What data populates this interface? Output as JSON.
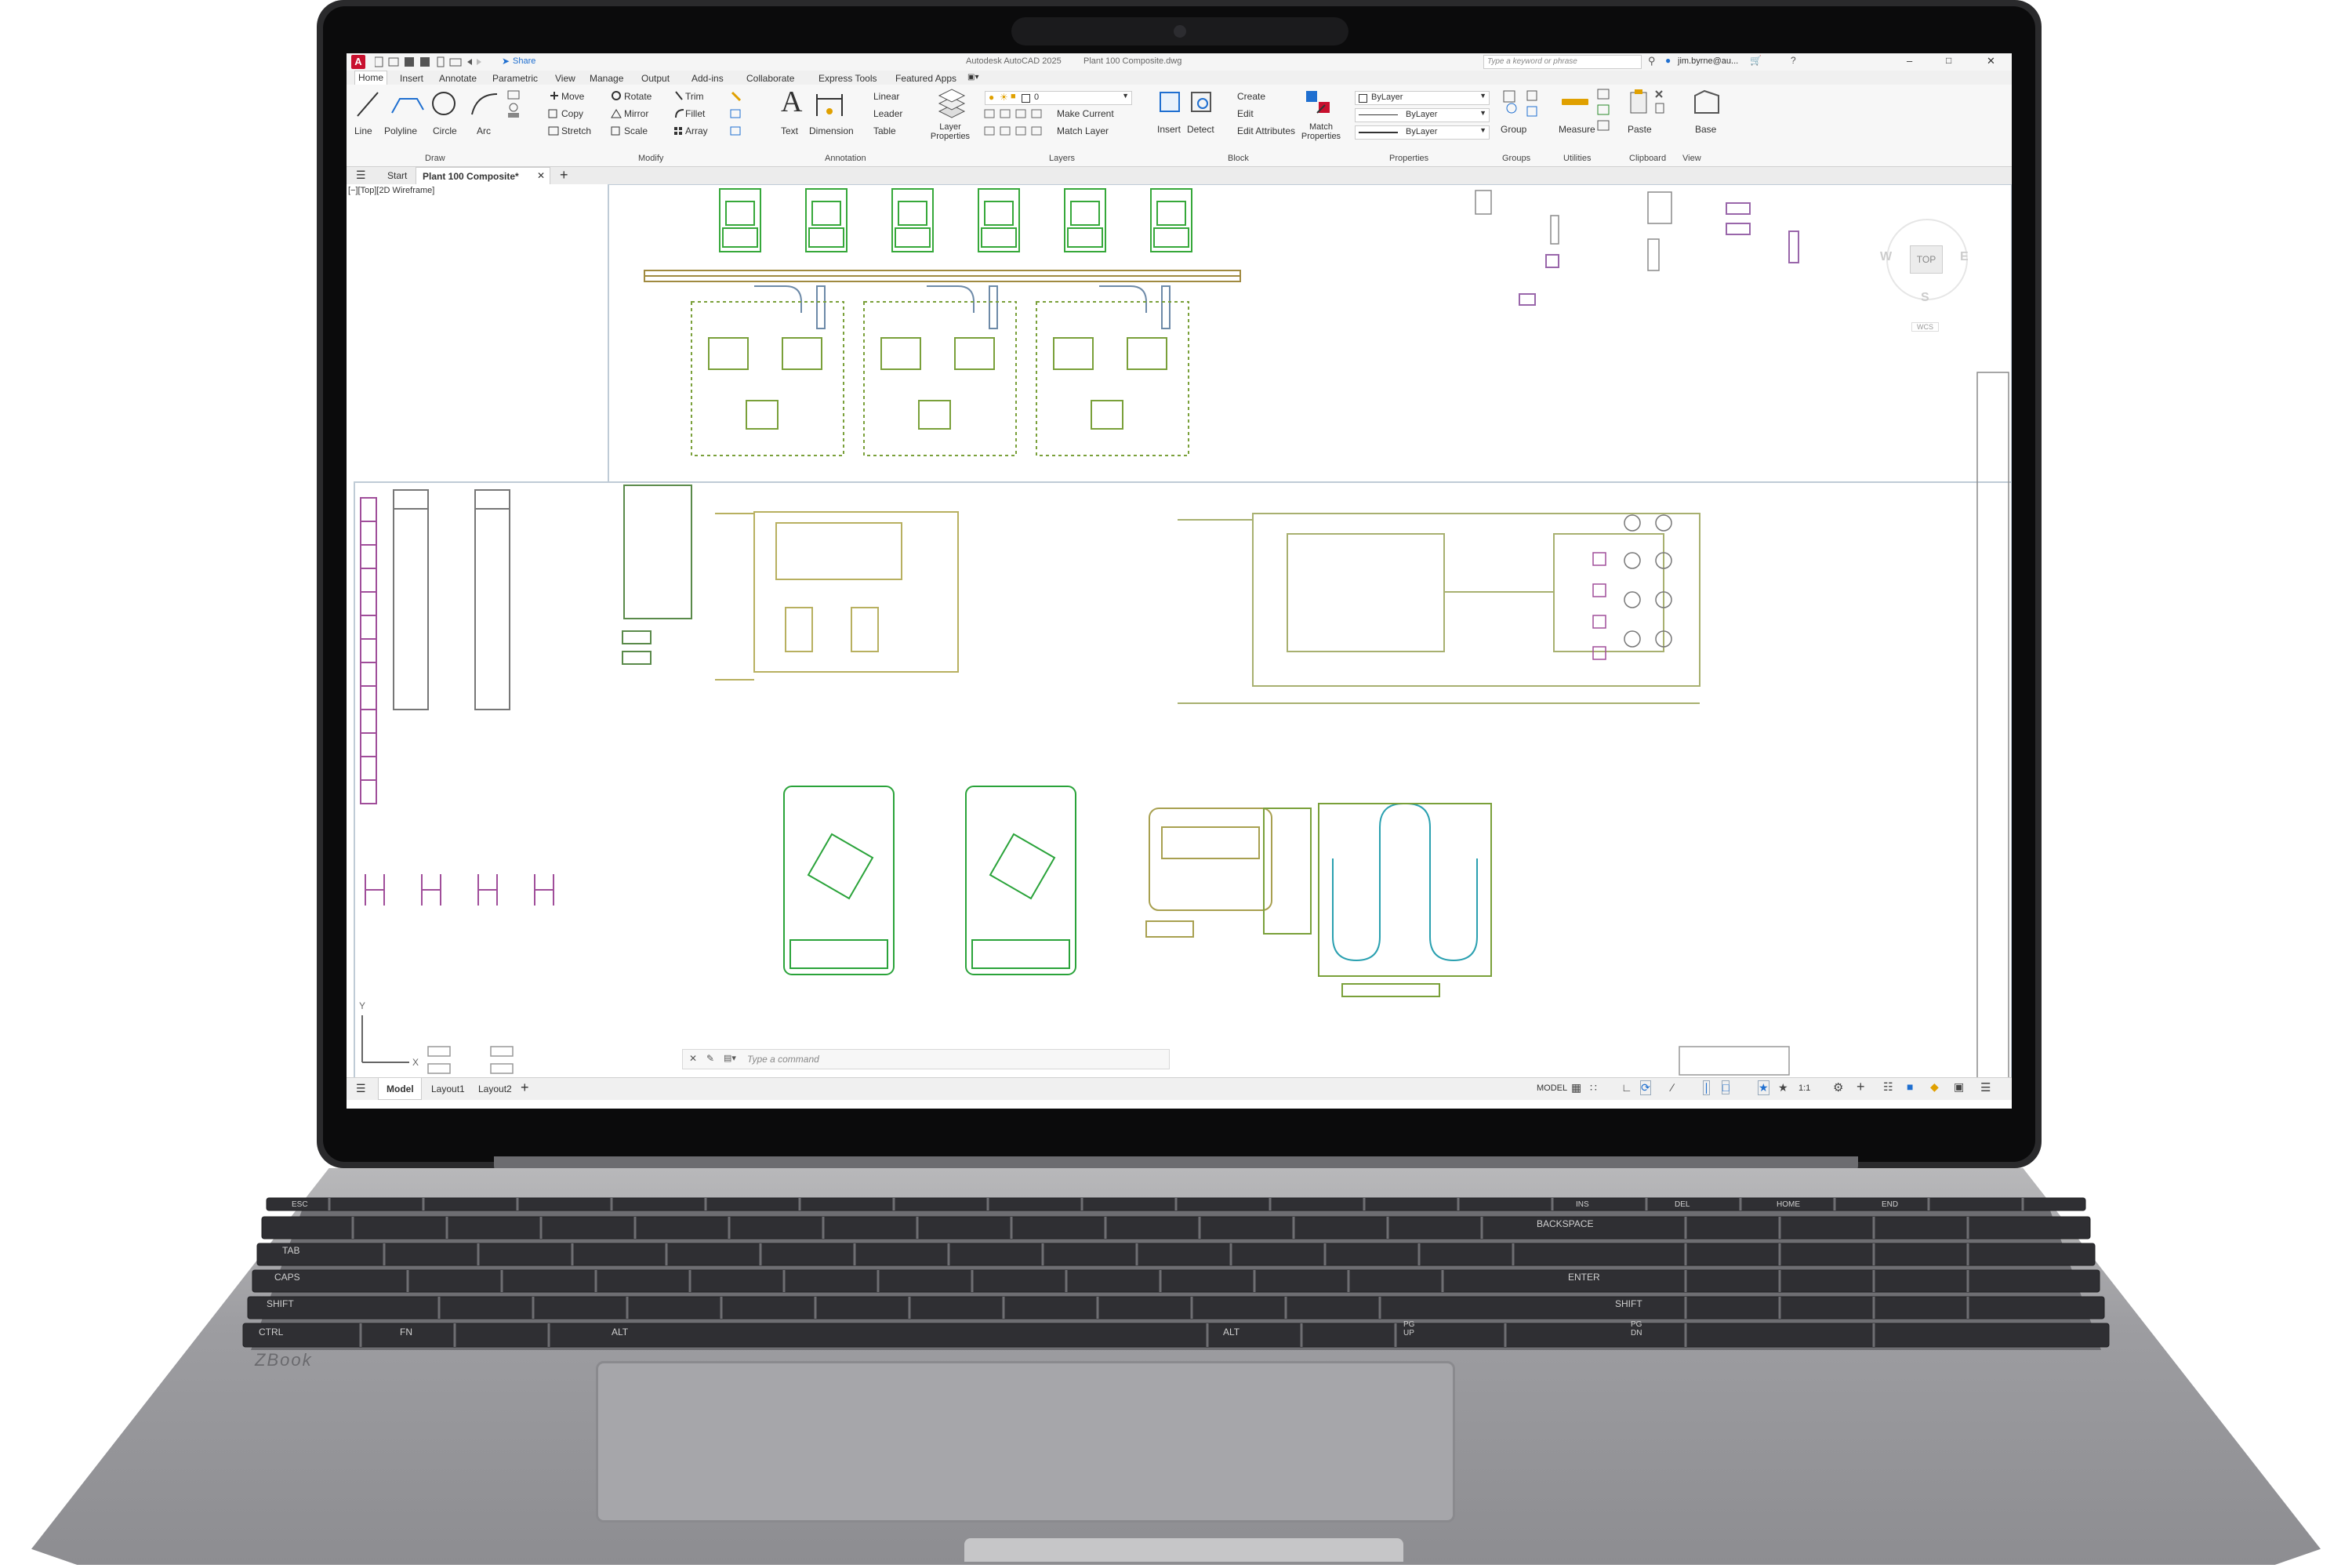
{
  "app": {
    "title": "Autodesk AutoCAD 2025",
    "filename": "Plant 100 Composite.dwg",
    "share_label": "Share",
    "search_placeholder": "Type a keyword or phrase",
    "user": "jim.byrne@au..."
  },
  "ribbon_tabs": [
    "Home",
    "Insert",
    "Annotate",
    "Parametric",
    "View",
    "Manage",
    "Output",
    "Add-ins",
    "Collaborate",
    "Express Tools",
    "Featured Apps"
  ],
  "panels": {
    "draw": {
      "label": "Draw",
      "tools": [
        "Line",
        "Polyline",
        "Circle",
        "Arc"
      ]
    },
    "modify": {
      "label": "Modify",
      "tools": [
        "Move",
        "Rotate",
        "Trim",
        "Copy",
        "Mirror",
        "Fillet",
        "Stretch",
        "Scale",
        "Array"
      ]
    },
    "annotation": {
      "label": "Annotation",
      "tools": [
        "Text",
        "Dimension",
        "Linear",
        "Leader",
        "Table"
      ]
    },
    "layers": {
      "label": "Layers",
      "layer_properties": "Layer Properties",
      "current_layer": "0",
      "make_current": "Make Current",
      "match_layer": "Match Layer"
    },
    "block": {
      "label": "Block",
      "insert": "Insert",
      "detect": "Detect",
      "create": "Create",
      "edit": "Edit",
      "edit_attributes": "Edit Attributes"
    },
    "properties": {
      "label": "Properties",
      "match": "Match Properties",
      "color": "ByLayer",
      "linetype": "ByLayer",
      "lineweight": "ByLayer"
    },
    "groups": {
      "label": "Groups",
      "group": "Group"
    },
    "utilities": {
      "label": "Utilities",
      "measure": "Measure"
    },
    "clipboard": {
      "label": "Clipboard",
      "paste": "Paste"
    },
    "view": {
      "label": "View",
      "base": "Base"
    }
  },
  "file_tabs": {
    "start": "Start",
    "active": "Plant 100 Composite*"
  },
  "viewport": {
    "label": "[−][Top][2D Wireframe]"
  },
  "viewcube": {
    "top": "TOP",
    "west": "W",
    "east": "E",
    "south": "S",
    "wcs": "WCS"
  },
  "command": {
    "placeholder": "Type a command"
  },
  "layout_tabs": [
    "Model",
    "Layout1",
    "Layout2"
  ],
  "status": {
    "model": "MODEL",
    "scale": "1:1"
  },
  "laptop": {
    "brand": "ZBook"
  },
  "keyboard_labels": [
    "ESC",
    "TAB",
    "CAPS",
    "SHIFT",
    "CTRL",
    "FN",
    "ALT",
    "BACKSPACE",
    "ENTER",
    "SHIFT",
    "ALT",
    "PG UP",
    "PG DN",
    "HOME",
    "END",
    "INS",
    "DEL"
  ]
}
